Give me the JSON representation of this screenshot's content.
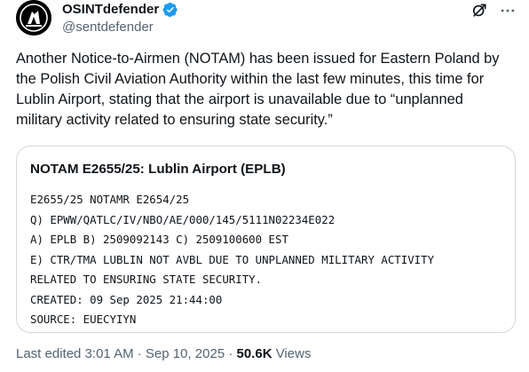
{
  "header": {
    "display_name": "OSINTdefender",
    "handle": "@sentdefender",
    "icons": [
      "avatar",
      "verified-badge-icon",
      "grok-icon",
      "more-icon"
    ]
  },
  "tweet": {
    "text": "Another Notice-to-Airmen (NOTAM) has been issued for Eastern Poland by the Polish Civil Aviation Authority within the last few minutes, this time for Lublin Airport, stating that the airport is unavailable due to “unplanned military activity related to ensuring state security.”"
  },
  "card": {
    "title": "NOTAM E2655/25: Lublin Airport (EPLB)",
    "lines": [
      "E2655/25 NOTAMR E2654/25",
      "Q) EPWW/QATLC/IV/NBO/AE/000/145/5111N02234E022",
      "A) EPLB B) 2509092143 C) 2509100600 EST",
      "E) CTR/TMA LUBLIN NOT AVBL DUE TO UNPLANNED MILITARY ACTIVITY",
      "RELATED TO ENSURING STATE SECURITY.",
      "CREATED: 09 Sep 2025 21:44:00",
      "SOURCE: EUECYIYN"
    ]
  },
  "footer": {
    "edited": "Last edited 3:01 AM · Sep 10, 2025 · ",
    "views_count": "50.6K",
    "views_label": " Views"
  },
  "colors": {
    "text_primary": "#0f1419",
    "text_secondary": "#536471",
    "verified_blue": "#1d9bf0",
    "card_border": "#cfd9de"
  }
}
